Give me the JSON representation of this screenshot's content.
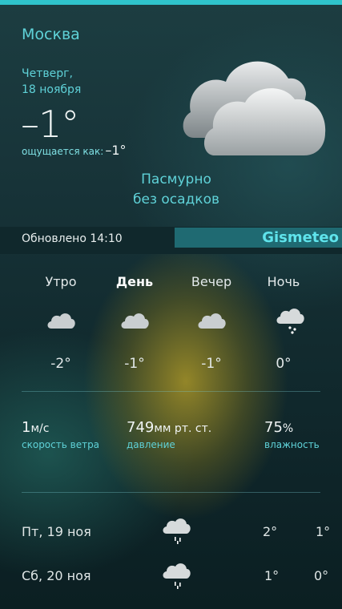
{
  "header": {
    "city": "Москва",
    "weekday": "Четверг,",
    "date": "18 ноября",
    "temperature": "–1°",
    "feels_like_label": "ощущается как:",
    "feels_like_value": "–1°",
    "condition_line1": "Пасмурно",
    "condition_line2": "без осадков",
    "main_icon": "cloud-icon"
  },
  "source_bar": {
    "updated": "Обновлено 14:10",
    "provider": "Gismeteo"
  },
  "day_parts": [
    {
      "label": "Утро",
      "icon": "cloud-icon",
      "temp": "-2°"
    },
    {
      "label": "День",
      "icon": "cloud-icon",
      "temp": "-1°"
    },
    {
      "label": "Вечер",
      "icon": "cloud-icon",
      "temp": "-1°"
    },
    {
      "label": "Ночь",
      "icon": "cloud-snow-icon",
      "temp": "0°"
    }
  ],
  "stats": {
    "wind_value": "1",
    "wind_unit": "м/с",
    "wind_label": "скорость ветра",
    "pressure_value": "749",
    "pressure_unit": "мм рт. ст.",
    "pressure_label": "давление",
    "humidity_value": "75",
    "humidity_unit": "%",
    "humidity_label": "влажность"
  },
  "forecast": [
    {
      "date": "Пт, 19 ноя",
      "icon": "cloud-snow-icon",
      "day": "2°",
      "night": "1°"
    },
    {
      "date": "Сб, 20 ноя",
      "icon": "cloud-snow-icon",
      "day": "1°",
      "night": "0°"
    }
  ],
  "colors": {
    "accent": "#5fd2d8",
    "top_bar": "#2fc4cc",
    "provider_bar": "#1f6a72"
  }
}
